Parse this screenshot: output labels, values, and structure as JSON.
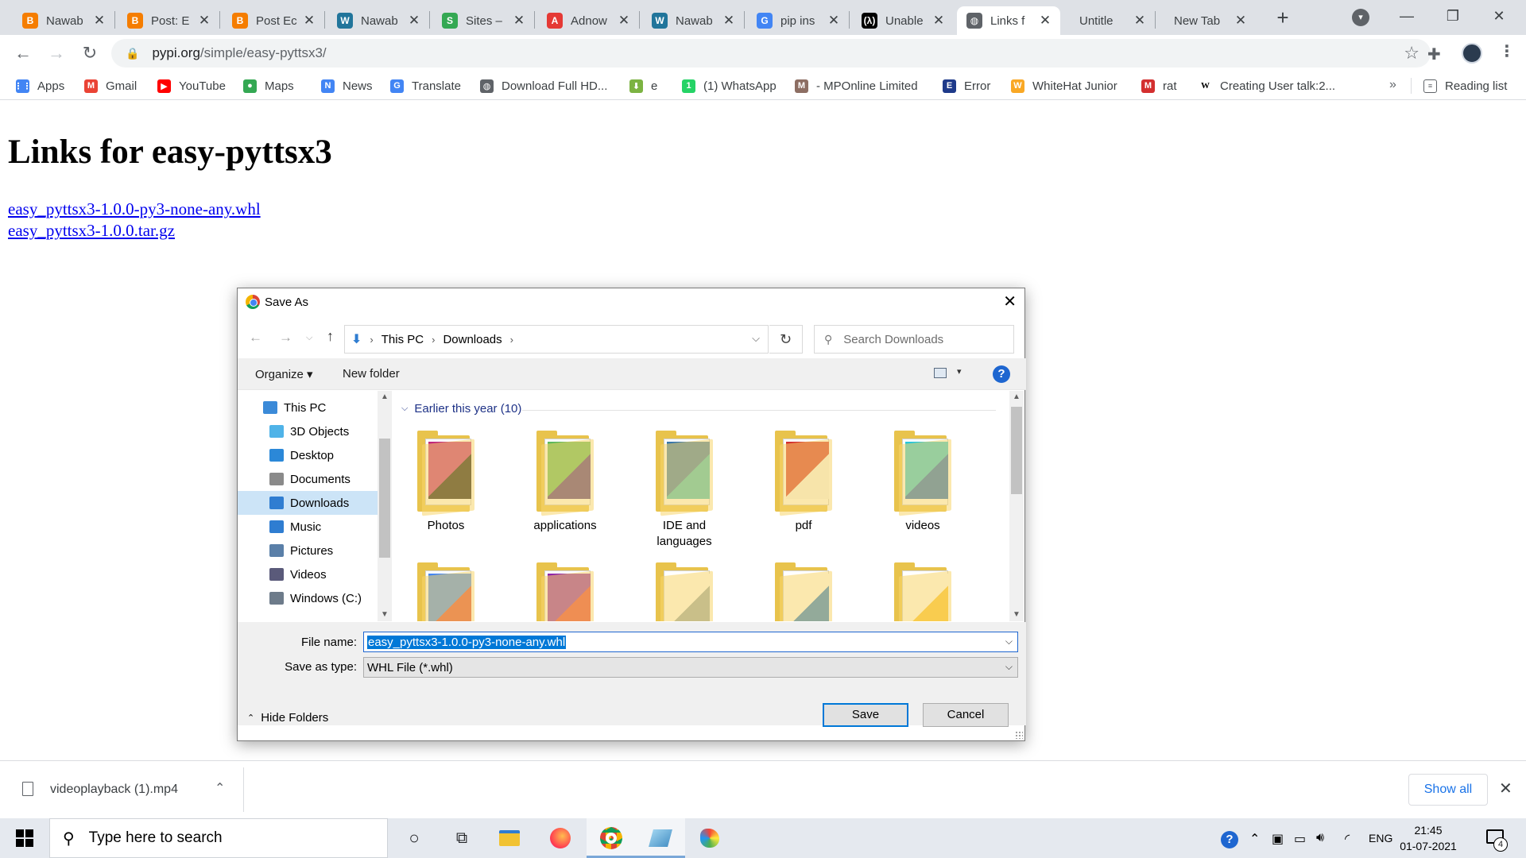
{
  "browser": {
    "tabs": [
      {
        "title": "Nawab",
        "icon": "blogger-icon",
        "color": "#f57d00",
        "glyph": "B"
      },
      {
        "title": "Post: E",
        "icon": "blogger-icon",
        "color": "#f57d00",
        "glyph": "B"
      },
      {
        "title": "Post Ec",
        "icon": "blogger-icon",
        "color": "#f57d00",
        "glyph": "B"
      },
      {
        "title": "Nawab",
        "icon": "wordpress-icon",
        "color": "#21759b",
        "glyph": "W"
      },
      {
        "title": "Sites –",
        "icon": "google-sites-icon",
        "color": "#34a853",
        "glyph": "S"
      },
      {
        "title": "Adnow",
        "icon": "adnow-icon",
        "color": "#e53935",
        "glyph": "A"
      },
      {
        "title": "Nawab",
        "icon": "wordpress-icon",
        "color": "#21759b",
        "glyph": "W"
      },
      {
        "title": "pip ins",
        "icon": "google-icon",
        "color": "#4285f4",
        "glyph": "G"
      },
      {
        "title": "Unable",
        "icon": "dev-icon",
        "color": "#000000",
        "glyph": "(λ)"
      },
      {
        "title": "Links f",
        "icon": "globe-icon",
        "color": "#5f6368",
        "glyph": "◍",
        "active": true
      },
      {
        "title": "Untitle",
        "icon": "",
        "color": "",
        "glyph": ""
      },
      {
        "title": "New Tab",
        "icon": "",
        "color": "",
        "glyph": ""
      }
    ],
    "new_tab_glyph": "+",
    "tab_search_glyph": "▾",
    "window_controls": {
      "minimize": "—",
      "restore": "❐",
      "close": "✕"
    },
    "url_host": "pypi.org",
    "url_path": "/simple/easy-pyttsx3/",
    "bookmarks": [
      {
        "label": "Apps",
        "icon": "apps-grid-icon",
        "color": "#4285f4",
        "glyph": "⋮⋮"
      },
      {
        "label": "Gmail",
        "icon": "gmail-icon",
        "color": "#ea4335",
        "glyph": "M"
      },
      {
        "label": "YouTube",
        "icon": "youtube-icon",
        "color": "#ff0000",
        "glyph": "▶"
      },
      {
        "label": "Maps",
        "icon": "maps-pin-icon",
        "color": "#34a853",
        "glyph": "●"
      },
      {
        "label": "News",
        "icon": "google-news-icon",
        "color": "#4285f4",
        "glyph": "N"
      },
      {
        "label": "Translate",
        "icon": "translate-icon",
        "color": "#4285f4",
        "glyph": "G"
      },
      {
        "label": "Download Full HD...",
        "icon": "globe-icon",
        "color": "#5f6368",
        "glyph": "◍"
      },
      {
        "label": "e",
        "icon": "download-arrow-icon",
        "color": "#7cb342",
        "glyph": "⬇"
      },
      {
        "label": "(1) WhatsApp",
        "icon": "whatsapp-icon",
        "color": "#25d366",
        "glyph": "1"
      },
      {
        "label": "- MPOnline Limited",
        "icon": "mponline-icon",
        "color": "#8d6e63",
        "glyph": "M"
      },
      {
        "label": "Error",
        "icon": "error-page-icon",
        "color": "#1e3a8a",
        "glyph": "E"
      },
      {
        "label": "WhiteHat Junior",
        "icon": "whitehat-icon",
        "color": "#f9a825",
        "glyph": "W"
      },
      {
        "label": "rat",
        "icon": "rat-site-icon",
        "color": "#d32f2f",
        "glyph": "M"
      },
      {
        "label": "Creating User talk:2...",
        "icon": "wikipedia-icon",
        "color": "#ffffff",
        "glyph": "W"
      }
    ],
    "bookmarks_more": "»",
    "reading_list": "Reading list"
  },
  "page": {
    "heading": "Links for easy-pyttsx3",
    "links": [
      "easy_pyttsx3-1.0.0-py3-none-any.whl",
      "easy_pyttsx3-1.0.0.tar.gz"
    ]
  },
  "dialog": {
    "title": "Save As",
    "breadcrumb": [
      "This PC",
      "Downloads"
    ],
    "search_placeholder": "Search Downloads",
    "organize": "Organize ▾",
    "new_folder": "New folder",
    "nav_items": [
      {
        "label": "This PC",
        "icon": "this-pc-icon",
        "color": "#3b8ad8",
        "indent": 0
      },
      {
        "label": "3D Objects",
        "icon": "3d-objects-icon",
        "color": "#4fb3e8",
        "indent": 1
      },
      {
        "label": "Desktop",
        "icon": "desktop-icon",
        "color": "#2b88d8",
        "indent": 1
      },
      {
        "label": "Documents",
        "icon": "documents-icon",
        "color": "#8a8a8a",
        "indent": 1
      },
      {
        "label": "Downloads",
        "icon": "downloads-icon",
        "color": "#2f7dd1",
        "indent": 1,
        "selected": true
      },
      {
        "label": "Music",
        "icon": "music-icon",
        "color": "#2f7dd1",
        "indent": 1
      },
      {
        "label": "Pictures",
        "icon": "pictures-icon",
        "color": "#5a7fa8",
        "indent": 1
      },
      {
        "label": "Videos",
        "icon": "videos-icon",
        "color": "#5a5a7a",
        "indent": 1
      },
      {
        "label": "Windows (C:)",
        "icon": "drive-icon",
        "color": "#6d7b8a",
        "indent": 1
      }
    ],
    "group_header": "Earlier this year (10)",
    "folders_row1": [
      {
        "label": "Photos",
        "thumb": "photos-folder-icon",
        "c1": "#c0267c",
        "c2": "#111111"
      },
      {
        "label": "applications",
        "thumb": "applications-folder-icon",
        "c1": "#5cb85c",
        "c2": "#4b2b82"
      },
      {
        "label": "IDE and languages",
        "thumb": "python-folder-icon",
        "c1": "#3776ab",
        "c2": "#3bbfbf"
      },
      {
        "label": "pdf",
        "thumb": "pdf-folder-icon",
        "c1": "#d32f2f",
        "c2": "#f5f5f5"
      },
      {
        "label": "videos",
        "thumb": "videos-folder-icon",
        "c1": "#26c6da",
        "c2": "#1565c0"
      }
    ],
    "folders_row2": [
      {
        "thumb": "chrome-folder-icon",
        "c1": "#4285f4",
        "c2": "#db4437"
      },
      {
        "thumb": "winrar-folder-icon",
        "c1": "#8e24aa",
        "c2": "#e53935"
      },
      {
        "thumb": "docs-folder-icon",
        "c1": "#ffffff",
        "c2": "#90a4ae"
      },
      {
        "thumb": "setup-folder-icon",
        "c1": "#ffffff",
        "c2": "#1976d2"
      },
      {
        "thumb": "misc-folder-icon",
        "c1": "#ffffff",
        "c2": "#fbc02d"
      }
    ],
    "file_name_label": "File name:",
    "file_name_value": "easy_pyttsx3-1.0.0-py3-none-any.whl",
    "save_as_type_label": "Save as type:",
    "save_as_type_value": "WHL File (*.whl)",
    "hide_folders": "Hide Folders",
    "save": "Save",
    "cancel": "Cancel"
  },
  "download_shelf": {
    "file": "videoplayback (1).mp4",
    "show_all": "Show all"
  },
  "taskbar": {
    "search_placeholder": "Type here to search",
    "language": "ENG",
    "time": "21:45",
    "date": "01-07-2021",
    "notification_count": "4"
  }
}
